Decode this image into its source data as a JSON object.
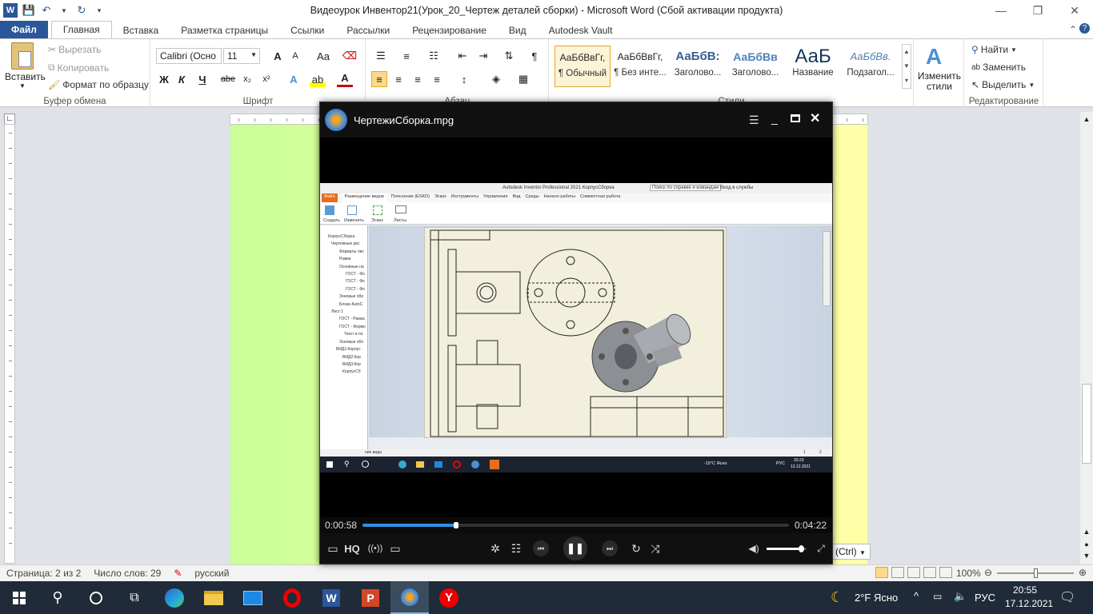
{
  "word": {
    "window_title": "Видеоурок Инвентор21(Урок_20_Чертеж деталей сборки)  -  Microsoft Word (Сбой активации продукта)",
    "tabs": [
      "Файл",
      "Главная",
      "Вставка",
      "Разметка страницы",
      "Ссылки",
      "Рассылки",
      "Рецензирование",
      "Вид",
      "Autodesk Vault"
    ],
    "clipboard": {
      "paste": "Вставить",
      "cut": "Вырезать",
      "copy": "Копировать",
      "format_painter": "Формат по образцу",
      "label": "Буфер обмена"
    },
    "font": {
      "name": "Calibri (Осно",
      "size": "11",
      "label": "Шрифт",
      "bold": "Ж",
      "italic": "К",
      "underline": "Ч",
      "strike": "abe",
      "sub": "x₂",
      "sup": "x²",
      "grow": "A",
      "shrink": "A",
      "case": "Aa"
    },
    "paragraph": {
      "label": "Абзац"
    },
    "styles": {
      "label": "Стили",
      "items": [
        {
          "preview": "АаБбВвГг,",
          "name": "¶ Обычный"
        },
        {
          "preview": "АаБбВвГг,",
          "name": "¶ Без инте..."
        },
        {
          "preview": "АаБбВ:",
          "name": "Заголово..."
        },
        {
          "preview": "АаБбВв",
          "name": "Заголово..."
        },
        {
          "preview": "АаБ",
          "name": "Название"
        },
        {
          "preview": "АаБбВв.",
          "name": "Подзагол..."
        }
      ],
      "change": "Изменить стили"
    },
    "editing": {
      "find": "Найти",
      "replace": "Заменить",
      "select": "Выделить",
      "label": "Редактирование"
    },
    "status": {
      "page": "Страница: 2 из 2",
      "words": "Число слов: 29",
      "lang": "русский",
      "zoom": "100%"
    },
    "paste_options": "(Ctrl)"
  },
  "player": {
    "title": "ЧертежиСборка.mpg",
    "elapsed": "0:00:58",
    "total": "0:04:22",
    "progress": 0.22,
    "volume": 0.85,
    "hq": "HQ"
  },
  "video": {
    "app_title": "Autodesk Inventor Professional 2021   КорпусСборка",
    "search": "Поиск по справке и командам",
    "signin": "Вход в службы",
    "tabs": [
      "Файл",
      "Размещение видов",
      "Пояснение (ЕSKD)",
      "Эскиз",
      "Инструменты",
      "Управление",
      "Вид",
      "Среды",
      "Начало работы",
      "Совместная работа"
    ],
    "tools": [
      "Создать",
      "Изменить",
      "Эскиз",
      "Листы"
    ],
    "tree": [
      "КорпусСборка",
      "Чертежные рес",
      "Форматы лис",
      "Рамки",
      "Основные на",
      "ГОСТ - Фо",
      "ГОСТ - Фо",
      "ГОСТ - Фо",
      "Зоновые обо",
      "Блоки AutoC",
      "Лист:1",
      "ГОСТ - Рамка",
      "ГОСТ - Формо",
      "Текст в по",
      "Зоновые обо",
      "ВИД1:Корпус",
      "ВИД2:Кор",
      "ВИД3:Кор",
      "КорпусСб"
    ],
    "status_left": "ние вида",
    "page_nums": [
      "1",
      "2"
    ],
    "taskbar_weather": "-15°C Ясно",
    "taskbar_lang": "РУС",
    "taskbar_time": "20:23",
    "taskbar_date": "13.12.2021"
  },
  "taskbar": {
    "weather": "2°F  Ясно",
    "lang": "РУС",
    "time": "20:55",
    "date": "17.12.2021"
  }
}
